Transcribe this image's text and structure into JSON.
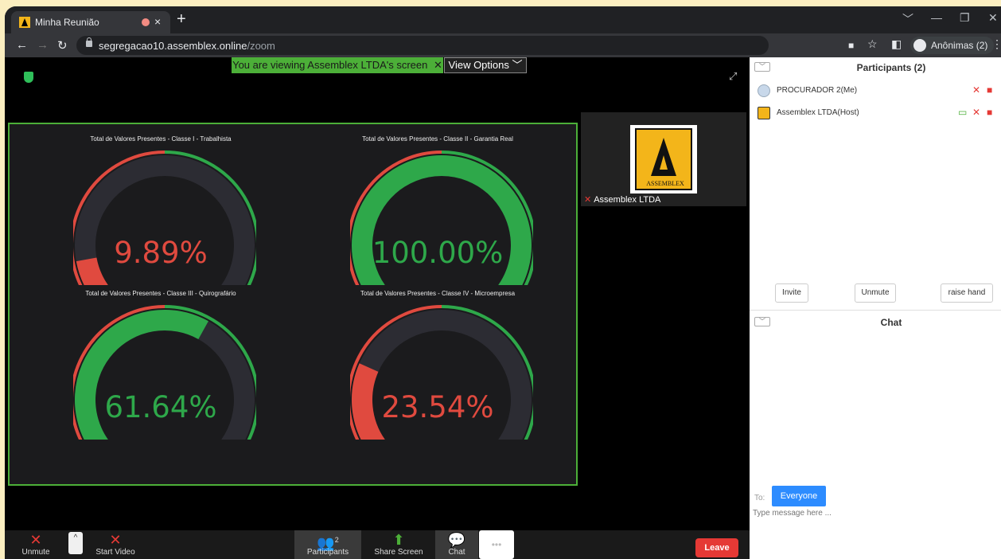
{
  "browser": {
    "tab_title": "Minha Reunião",
    "tab_close": "×",
    "new_tab": "+",
    "url_host": "segregacao10.assemblex.online",
    "url_path": "/zoom",
    "profile_label": "Anônimas (2)",
    "window_controls": [
      "﹀",
      "—",
      "❐",
      "✕"
    ]
  },
  "meeting": {
    "banner_text": "You are viewing Assemblex LTDA's screen",
    "view_options": "View Options ﹀",
    "gauges": [
      {
        "title": "Total de Valores Presentes - Classe I - Trabalhista",
        "value_text": "9.89%",
        "value": 9.89,
        "color": "#e04a3f"
      },
      {
        "title": "Total de Valores Presentes - Classe II - Garantia Real",
        "value_text": "100.00%",
        "value": 100.0,
        "color": "#2ea84a"
      },
      {
        "title": "Total de Valores Presentes - Classe III - Quirografário",
        "value_text": "61.64%",
        "value": 61.64,
        "color": "#2ea84a"
      },
      {
        "title": "Total de Valores Presentes - Classe IV - Microempresa",
        "value_text": "23.54%",
        "value": 23.54,
        "color": "#e04a3f"
      }
    ],
    "video_tile": {
      "name": "Assemblex LTDA",
      "logo_text": "ASSEMBLEX"
    }
  },
  "bottom_bar": {
    "unmute": "Unmute",
    "start_video": "Start Video",
    "participants": "Participants",
    "participants_count": "2",
    "share_screen": "Share Screen",
    "chat": "Chat",
    "more": "•••",
    "leave": "Leave"
  },
  "participants_panel": {
    "title": "Participants (2)",
    "participants": [
      {
        "name": "PROCURADOR 2(Me)"
      },
      {
        "name": "Assemblex LTDA(Host)"
      }
    ],
    "invite": "Invite",
    "unmute": "Unmute",
    "raise_hand": "raise hand"
  },
  "chat_panel": {
    "title": "Chat",
    "to_label": "To:",
    "recipient": "Everyone",
    "placeholder": "Type message here ..."
  },
  "colors": {
    "accent_green": "#4caf38",
    "leave_red": "#e53935",
    "chat_blue": "#2d8cff",
    "gauge_track": "#2c2c33"
  }
}
